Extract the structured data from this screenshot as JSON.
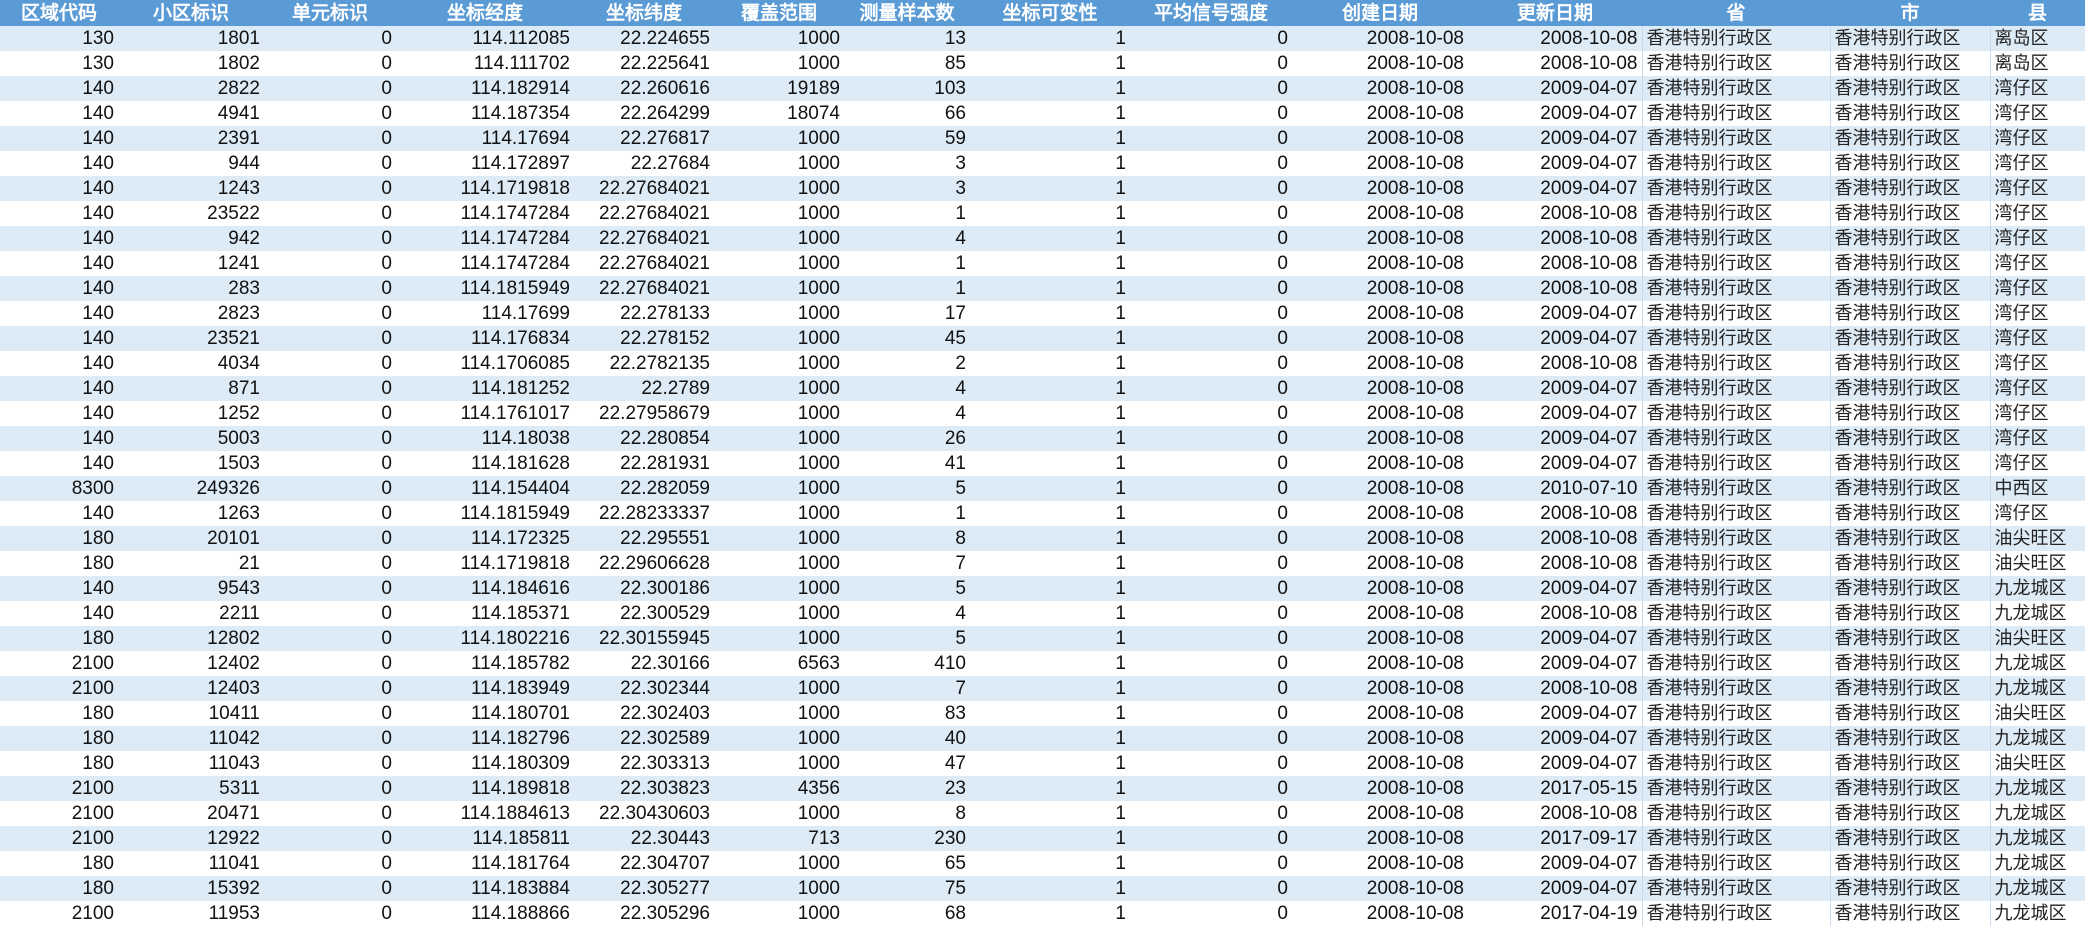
{
  "sheet": {
    "header_color": "#5b9bd5",
    "band_color": "#ddebf7",
    "columns": [
      "区域代码",
      "小区标识",
      "单元标识",
      "坐标经度",
      "坐标纬度",
      "覆盖范围",
      "测量样本数",
      "坐标可变性",
      "平均信号强度",
      "创建日期",
      "更新日期",
      "省",
      "市",
      "县"
    ],
    "rows": [
      [
        "130",
        "1801",
        "0",
        "114.112085",
        "22.224655",
        "1000",
        "13",
        "1",
        "0",
        "2008-10-08",
        "2008-10-08",
        "香港特别行政区",
        "香港特别行政区",
        "离岛区"
      ],
      [
        "130",
        "1802",
        "0",
        "114.111702",
        "22.225641",
        "1000",
        "85",
        "1",
        "0",
        "2008-10-08",
        "2008-10-08",
        "香港特别行政区",
        "香港特别行政区",
        "离岛区"
      ],
      [
        "140",
        "2822",
        "0",
        "114.182914",
        "22.260616",
        "19189",
        "103",
        "1",
        "0",
        "2008-10-08",
        "2009-04-07",
        "香港特别行政区",
        "香港特别行政区",
        "湾仔区"
      ],
      [
        "140",
        "4941",
        "0",
        "114.187354",
        "22.264299",
        "18074",
        "66",
        "1",
        "0",
        "2008-10-08",
        "2009-04-07",
        "香港特别行政区",
        "香港特别行政区",
        "湾仔区"
      ],
      [
        "140",
        "2391",
        "0",
        "114.17694",
        "22.276817",
        "1000",
        "59",
        "1",
        "0",
        "2008-10-08",
        "2009-04-07",
        "香港特别行政区",
        "香港特别行政区",
        "湾仔区"
      ],
      [
        "140",
        "944",
        "0",
        "114.172897",
        "22.27684",
        "1000",
        "3",
        "1",
        "0",
        "2008-10-08",
        "2009-04-07",
        "香港特别行政区",
        "香港特别行政区",
        "湾仔区"
      ],
      [
        "140",
        "1243",
        "0",
        "114.1719818",
        "22.27684021",
        "1000",
        "3",
        "1",
        "0",
        "2008-10-08",
        "2009-04-07",
        "香港特别行政区",
        "香港特别行政区",
        "湾仔区"
      ],
      [
        "140",
        "23522",
        "0",
        "114.1747284",
        "22.27684021",
        "1000",
        "1",
        "1",
        "0",
        "2008-10-08",
        "2008-10-08",
        "香港特别行政区",
        "香港特别行政区",
        "湾仔区"
      ],
      [
        "140",
        "942",
        "0",
        "114.1747284",
        "22.27684021",
        "1000",
        "4",
        "1",
        "0",
        "2008-10-08",
        "2008-10-08",
        "香港特别行政区",
        "香港特别行政区",
        "湾仔区"
      ],
      [
        "140",
        "1241",
        "0",
        "114.1747284",
        "22.27684021",
        "1000",
        "1",
        "1",
        "0",
        "2008-10-08",
        "2008-10-08",
        "香港特别行政区",
        "香港特别行政区",
        "湾仔区"
      ],
      [
        "140",
        "283",
        "0",
        "114.1815949",
        "22.27684021",
        "1000",
        "1",
        "1",
        "0",
        "2008-10-08",
        "2008-10-08",
        "香港特别行政区",
        "香港特别行政区",
        "湾仔区"
      ],
      [
        "140",
        "2823",
        "0",
        "114.17699",
        "22.278133",
        "1000",
        "17",
        "1",
        "0",
        "2008-10-08",
        "2009-04-07",
        "香港特别行政区",
        "香港特别行政区",
        "湾仔区"
      ],
      [
        "140",
        "23521",
        "0",
        "114.176834",
        "22.278152",
        "1000",
        "45",
        "1",
        "0",
        "2008-10-08",
        "2009-04-07",
        "香港特别行政区",
        "香港特别行政区",
        "湾仔区"
      ],
      [
        "140",
        "4034",
        "0",
        "114.1706085",
        "22.2782135",
        "1000",
        "2",
        "1",
        "0",
        "2008-10-08",
        "2008-10-08",
        "香港特别行政区",
        "香港特别行政区",
        "湾仔区"
      ],
      [
        "140",
        "871",
        "0",
        "114.181252",
        "22.2789",
        "1000",
        "4",
        "1",
        "0",
        "2008-10-08",
        "2009-04-07",
        "香港特别行政区",
        "香港特别行政区",
        "湾仔区"
      ],
      [
        "140",
        "1252",
        "0",
        "114.1761017",
        "22.27958679",
        "1000",
        "4",
        "1",
        "0",
        "2008-10-08",
        "2009-04-07",
        "香港特别行政区",
        "香港特别行政区",
        "湾仔区"
      ],
      [
        "140",
        "5003",
        "0",
        "114.18038",
        "22.280854",
        "1000",
        "26",
        "1",
        "0",
        "2008-10-08",
        "2009-04-07",
        "香港特别行政区",
        "香港特别行政区",
        "湾仔区"
      ],
      [
        "140",
        "1503",
        "0",
        "114.181628",
        "22.281931",
        "1000",
        "41",
        "1",
        "0",
        "2008-10-08",
        "2009-04-07",
        "香港特别行政区",
        "香港特别行政区",
        "湾仔区"
      ],
      [
        "8300",
        "249326",
        "0",
        "114.154404",
        "22.282059",
        "1000",
        "5",
        "1",
        "0",
        "2008-10-08",
        "2010-07-10",
        "香港特别行政区",
        "香港特别行政区",
        "中西区"
      ],
      [
        "140",
        "1263",
        "0",
        "114.1815949",
        "22.28233337",
        "1000",
        "1",
        "1",
        "0",
        "2008-10-08",
        "2008-10-08",
        "香港特别行政区",
        "香港特别行政区",
        "湾仔区"
      ],
      [
        "180",
        "20101",
        "0",
        "114.172325",
        "22.295551",
        "1000",
        "8",
        "1",
        "0",
        "2008-10-08",
        "2008-10-08",
        "香港特别行政区",
        "香港特别行政区",
        "油尖旺区"
      ],
      [
        "180",
        "21",
        "0",
        "114.1719818",
        "22.29606628",
        "1000",
        "7",
        "1",
        "0",
        "2008-10-08",
        "2008-10-08",
        "香港特别行政区",
        "香港特别行政区",
        "油尖旺区"
      ],
      [
        "140",
        "9543",
        "0",
        "114.184616",
        "22.300186",
        "1000",
        "5",
        "1",
        "0",
        "2008-10-08",
        "2009-04-07",
        "香港特别行政区",
        "香港特别行政区",
        "九龙城区"
      ],
      [
        "140",
        "2211",
        "0",
        "114.185371",
        "22.300529",
        "1000",
        "4",
        "1",
        "0",
        "2008-10-08",
        "2008-10-08",
        "香港特别行政区",
        "香港特别行政区",
        "九龙城区"
      ],
      [
        "180",
        "12802",
        "0",
        "114.1802216",
        "22.30155945",
        "1000",
        "5",
        "1",
        "0",
        "2008-10-08",
        "2009-04-07",
        "香港特别行政区",
        "香港特别行政区",
        "油尖旺区"
      ],
      [
        "2100",
        "12402",
        "0",
        "114.185782",
        "22.30166",
        "6563",
        "410",
        "1",
        "0",
        "2008-10-08",
        "2009-04-07",
        "香港特别行政区",
        "香港特别行政区",
        "九龙城区"
      ],
      [
        "2100",
        "12403",
        "0",
        "114.183949",
        "22.302344",
        "1000",
        "7",
        "1",
        "0",
        "2008-10-08",
        "2008-10-08",
        "香港特别行政区",
        "香港特别行政区",
        "九龙城区"
      ],
      [
        "180",
        "10411",
        "0",
        "114.180701",
        "22.302403",
        "1000",
        "83",
        "1",
        "0",
        "2008-10-08",
        "2009-04-07",
        "香港特别行政区",
        "香港特别行政区",
        "油尖旺区"
      ],
      [
        "180",
        "11042",
        "0",
        "114.182796",
        "22.302589",
        "1000",
        "40",
        "1",
        "0",
        "2008-10-08",
        "2009-04-07",
        "香港特别行政区",
        "香港特别行政区",
        "九龙城区"
      ],
      [
        "180",
        "11043",
        "0",
        "114.180309",
        "22.303313",
        "1000",
        "47",
        "1",
        "0",
        "2008-10-08",
        "2009-04-07",
        "香港特别行政区",
        "香港特别行政区",
        "油尖旺区"
      ],
      [
        "2100",
        "5311",
        "0",
        "114.189818",
        "22.303823",
        "4356",
        "23",
        "1",
        "0",
        "2008-10-08",
        "2017-05-15",
        "香港特别行政区",
        "香港特别行政区",
        "九龙城区"
      ],
      [
        "2100",
        "20471",
        "0",
        "114.1884613",
        "22.30430603",
        "1000",
        "8",
        "1",
        "0",
        "2008-10-08",
        "2008-10-08",
        "香港特别行政区",
        "香港特别行政区",
        "九龙城区"
      ],
      [
        "2100",
        "12922",
        "0",
        "114.185811",
        "22.30443",
        "713",
        "230",
        "1",
        "0",
        "2008-10-08",
        "2017-09-17",
        "香港特别行政区",
        "香港特别行政区",
        "九龙城区"
      ],
      [
        "180",
        "11041",
        "0",
        "114.181764",
        "22.304707",
        "1000",
        "65",
        "1",
        "0",
        "2008-10-08",
        "2009-04-07",
        "香港特别行政区",
        "香港特别行政区",
        "九龙城区"
      ],
      [
        "180",
        "15392",
        "0",
        "114.183884",
        "22.305277",
        "1000",
        "75",
        "1",
        "0",
        "2008-10-08",
        "2009-04-07",
        "香港特别行政区",
        "香港特别行政区",
        "九龙城区"
      ],
      [
        "2100",
        "11953",
        "0",
        "114.188866",
        "22.305296",
        "1000",
        "68",
        "1",
        "0",
        "2008-10-08",
        "2017-04-19",
        "香港特别行政区",
        "香港特别行政区",
        "九龙城区"
      ]
    ]
  }
}
